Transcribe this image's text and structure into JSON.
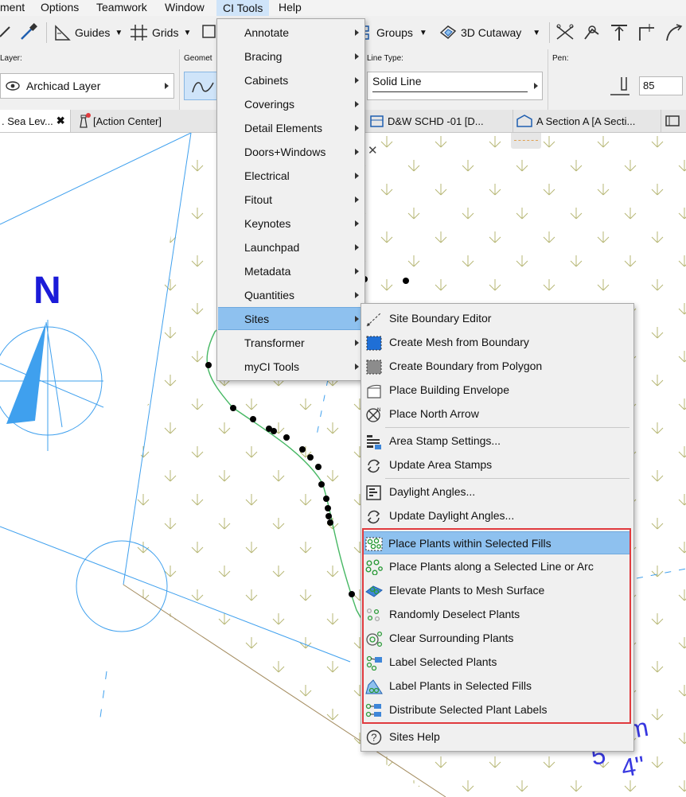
{
  "menubar": {
    "items": [
      "ment",
      "Options",
      "Teamwork",
      "Window",
      "CI Tools",
      "Help"
    ]
  },
  "toolbar": {
    "guides_label": "Guides",
    "grids_label": "Grids",
    "groups_label": "Groups",
    "cutaway_label": "3D Cutaway"
  },
  "infobox": {
    "layer_heading": "Layer:",
    "layer_value": "Archicad Layer",
    "geometry_heading": "Geomet",
    "line_type_heading": "Line Type:",
    "line_type_value": "Solid Line",
    "pen_heading": "Pen:",
    "pen_value": "85"
  },
  "tabs": {
    "tab1": ". Sea Lev...",
    "tab2": "[Action Center]",
    "tab3": "D&W SCHD -01 [D...",
    "tab4": "A Section A [A Secti..."
  },
  "ci_menu": {
    "items": [
      "Annotate",
      "Bracing",
      "Cabinets",
      "Coverings",
      "Detail Elements",
      "Doors+Windows",
      "Electrical",
      "Fitout",
      "Keynotes",
      "Launchpad",
      "Metadata",
      "Quantities",
      "Sites",
      "Transformer",
      "myCI Tools"
    ],
    "highlighted": "Sites"
  },
  "sites_menu": {
    "items": [
      {
        "label": "Site Boundary Editor",
        "icon": "site-boundary-editor-icon"
      },
      {
        "label": "Create Mesh from Boundary",
        "icon": "mesh-from-boundary-icon"
      },
      {
        "label": "Create Boundary from Polygon",
        "icon": "boundary-from-polygon-icon"
      },
      {
        "label": "Place Building Envelope",
        "icon": "building-envelope-icon"
      },
      {
        "label": "Place North Arrow",
        "icon": "north-arrow-icon"
      },
      {
        "label": "Area Stamp Settings...",
        "icon": "area-stamp-settings-icon"
      },
      {
        "label": "Update Area Stamps",
        "icon": "refresh-icon"
      },
      {
        "label": "Daylight Angles...",
        "icon": "daylight-angles-icon"
      },
      {
        "label": "Update Daylight Angles...",
        "icon": "refresh-icon"
      },
      {
        "label": "Place Plants within Selected Fills",
        "icon": "plants-in-fill-icon"
      },
      {
        "label": "Place Plants along a Selected Line or Arc",
        "icon": "plants-along-line-icon"
      },
      {
        "label": "Elevate Plants to Mesh Surface",
        "icon": "elevate-plants-icon"
      },
      {
        "label": "Randomly Deselect Plants",
        "icon": "deselect-plants-icon"
      },
      {
        "label": "Clear Surrounding Plants",
        "icon": "clear-plants-icon"
      },
      {
        "label": "Label Selected Plants",
        "icon": "label-plants-icon"
      },
      {
        "label": "Label Plants in Selected Fills",
        "icon": "label-plants-fills-icon"
      },
      {
        "label": "Distribute Selected Plant Labels",
        "icon": "distribute-labels-icon"
      },
      {
        "label": "Sites Help",
        "icon": "help-icon"
      }
    ],
    "highlighted": "Place Plants within Selected Fills"
  },
  "canvas": {
    "north_label": "N",
    "dim_text_1": "m",
    "dim_text_2": "5'",
    "dim_text_3": "4\""
  },
  "colors": {
    "accent_highlight": "#8ec1ef",
    "red_outline": "#e03a3e",
    "drawing_blue": "#3fa0ee",
    "north_blue": "#1b1bd8",
    "plant_symbol": "#b7b775",
    "curve_green": "#47b864"
  }
}
